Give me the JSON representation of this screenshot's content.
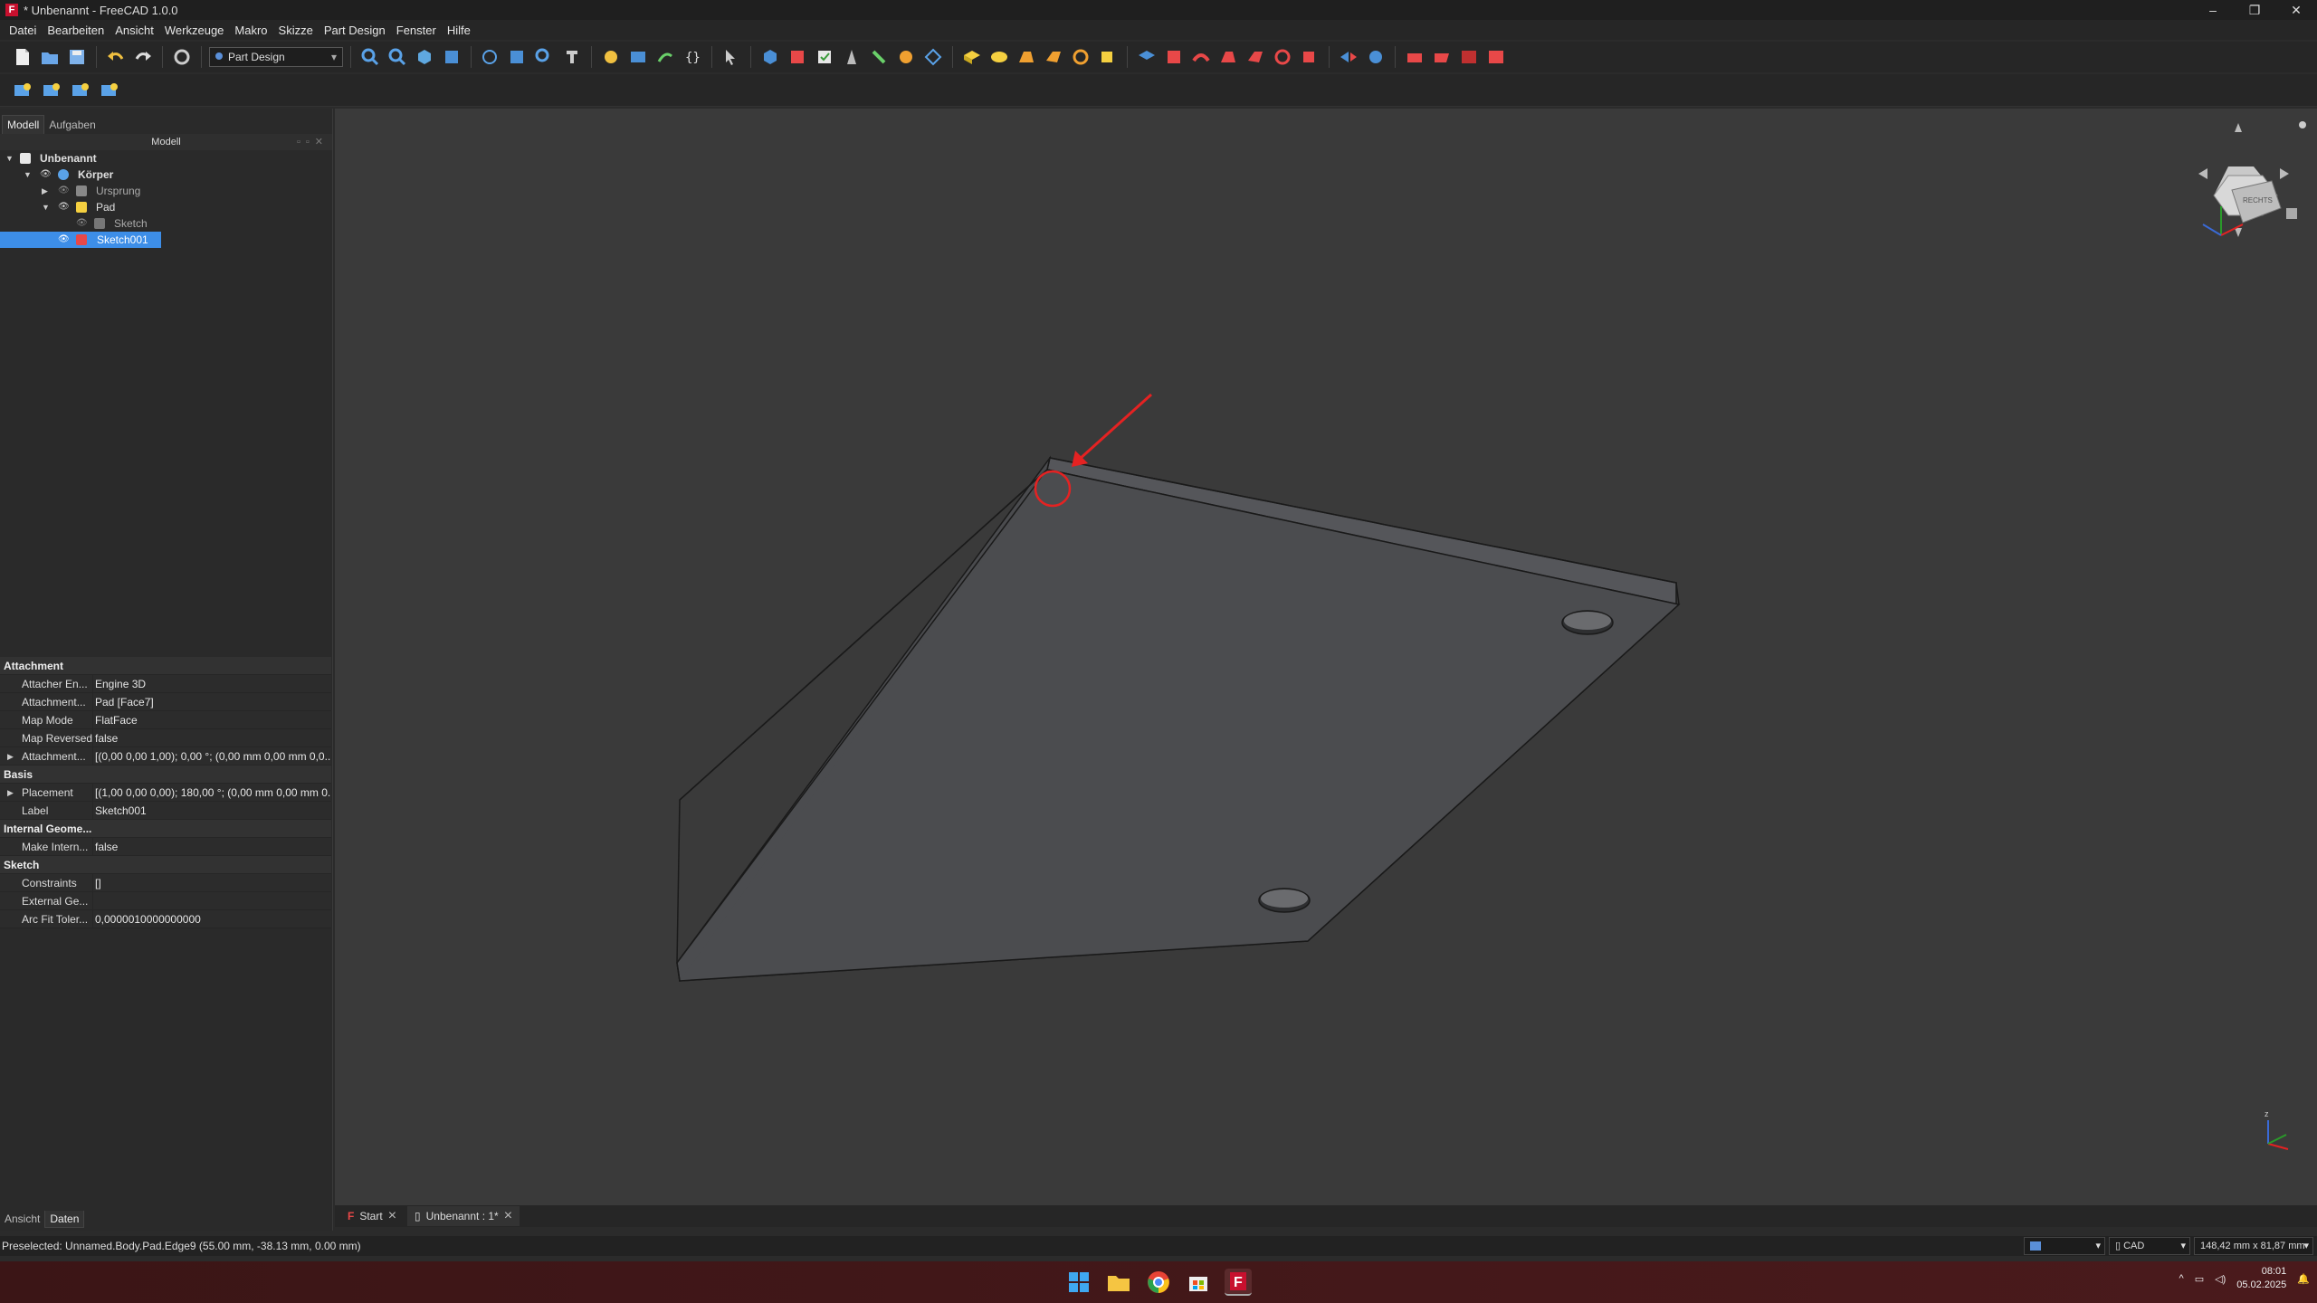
{
  "window": {
    "title": "* Unbenannt - FreeCAD 1.0.0",
    "app_icon": "F",
    "min": "–",
    "max": "❐",
    "close": "✕"
  },
  "menu": [
    "Datei",
    "Bearbeiten",
    "Ansicht",
    "Werkzeuge",
    "Makro",
    "Skizze",
    "Part Design",
    "Fenster",
    "Hilfe"
  ],
  "toolbar": {
    "workbench": "Part Design"
  },
  "left_panel": {
    "tabs": [
      "Modell",
      "Aufgaben"
    ],
    "tree_header": "Modell",
    "tree": [
      {
        "label": "Unbenannt",
        "level": 0
      },
      {
        "label": "Körper",
        "level": 1
      },
      {
        "label": "Ursprung",
        "level": 2
      },
      {
        "label": "Pad",
        "level": 2
      },
      {
        "label": "Sketch",
        "level": 3
      },
      {
        "label": "Sketch001",
        "level": 2,
        "selected": true
      }
    ],
    "bottom_tabs": [
      "Ansicht",
      "Daten"
    ]
  },
  "properties": {
    "sections": [
      {
        "title": "Attachment",
        "rows": [
          {
            "key": "Attacher En...",
            "value": "Engine 3D"
          },
          {
            "key": "Attachment...",
            "value": "Pad [Face7]"
          },
          {
            "key": "Map Mode",
            "value": "FlatFace"
          },
          {
            "key": "Map Reversed",
            "value": "false"
          },
          {
            "key": "Attachment...",
            "value": "[(0,00 0,00 1,00); 0,00 °; (0,00 mm  0,00 mm  0,0...",
            "expandable": true
          }
        ]
      },
      {
        "title": "Basis",
        "rows": [
          {
            "key": "Placement",
            "value": "[(1,00 0,00 0,00); 180,00 °; (0,00 mm  0,00 mm  0...",
            "expandable": true
          },
          {
            "key": "Label",
            "value": "Sketch001"
          }
        ]
      },
      {
        "title": "Internal Geome...",
        "rows": [
          {
            "key": "Make Intern...",
            "value": "false"
          }
        ]
      },
      {
        "title": "Sketch",
        "rows": [
          {
            "key": "Constraints",
            "value": "[]"
          },
          {
            "key": "External Ge...",
            "value": ""
          },
          {
            "key": "Arc Fit Toler...",
            "value": "0,0000010000000000"
          }
        ]
      }
    ]
  },
  "doc_tabs": [
    {
      "label": "Start"
    },
    {
      "label": "Unbenannt : 1*",
      "active": true
    }
  ],
  "status": {
    "text": "Preselected: Unnamed.Body.Pad.Edge9 (55.00 mm, -38.13 mm, 0.00 mm)",
    "nav_style": "CAD",
    "dimensions": "148,42 mm x 81,87 mm"
  },
  "taskbar": {
    "time": "08:01",
    "date": "05.02.2025"
  },
  "navcube": {
    "face_label": "RECHTS"
  },
  "colors": {
    "selection": "#3d8ee8",
    "annotation": "#e52222",
    "viewport_bg": "#3a3a3a",
    "taskbar": "#3b1516"
  }
}
